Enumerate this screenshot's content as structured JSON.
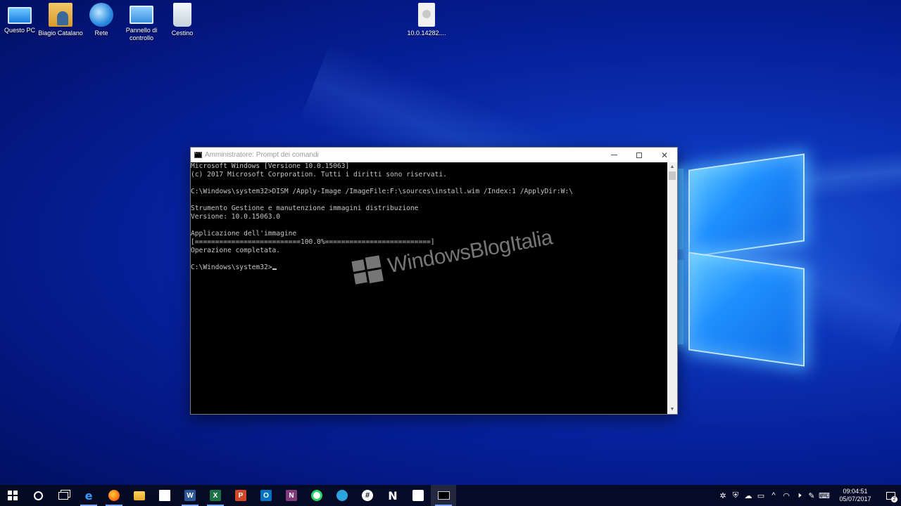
{
  "desktop": {
    "icons": [
      {
        "label": "Questo PC",
        "icon": "computer-icon"
      },
      {
        "label": "Biagio Catalano",
        "icon": "user-folder-icon"
      },
      {
        "label": "Rete",
        "icon": "network-icon"
      },
      {
        "label": "Pannello di controllo",
        "icon": "control-panel-icon"
      },
      {
        "label": "Cestino",
        "icon": "recycle-bin-icon"
      },
      {
        "label": "10.0.14282....",
        "icon": "disc-image-file-icon"
      }
    ]
  },
  "cmd": {
    "title": "Amministratore: Prompt dei comandi",
    "lines": [
      "Microsoft Windows [Versione 10.0.15063]",
      "(c) 2017 Microsoft Corporation. Tutti i diritti sono riservati.",
      "",
      "C:\\Windows\\system32>DISM /Apply-Image /ImageFile:F:\\sources\\install.wim /Index:1 /ApplyDir:W:\\",
      "",
      "Strumento Gestione e manutenzione immagini distribuzione",
      "Versione: 10.0.15063.0",
      "",
      "Applicazione dell'immagine",
      "[==========================100.0%==========================]",
      "Operazione completata.",
      "",
      "C:\\Windows\\system32>"
    ],
    "progress": 100.0
  },
  "watermark": {
    "text": "WindowsBlogItalia"
  },
  "taskbar": {
    "apps": [
      "start-icon",
      "search-icon",
      "task-view-icon",
      "edge-icon",
      "firefox-icon",
      "file-explorer-icon",
      "store-icon",
      "word-icon",
      "excel-icon",
      "powerpoint-icon",
      "outlook-icon",
      "onenote-icon",
      "whatsapp-icon",
      "telegram-icon",
      "slack-icon",
      "n-app-icon",
      "flipboard-icon",
      "command-prompt-icon"
    ],
    "time": "09:04:51",
    "date": "05/07/2017",
    "notification_count": "2"
  },
  "colors": {
    "desktop_bg": "#06209a",
    "console_bg": "#000000",
    "console_text": "#c6c6c6",
    "taskbar_bg": "#050a1e"
  }
}
